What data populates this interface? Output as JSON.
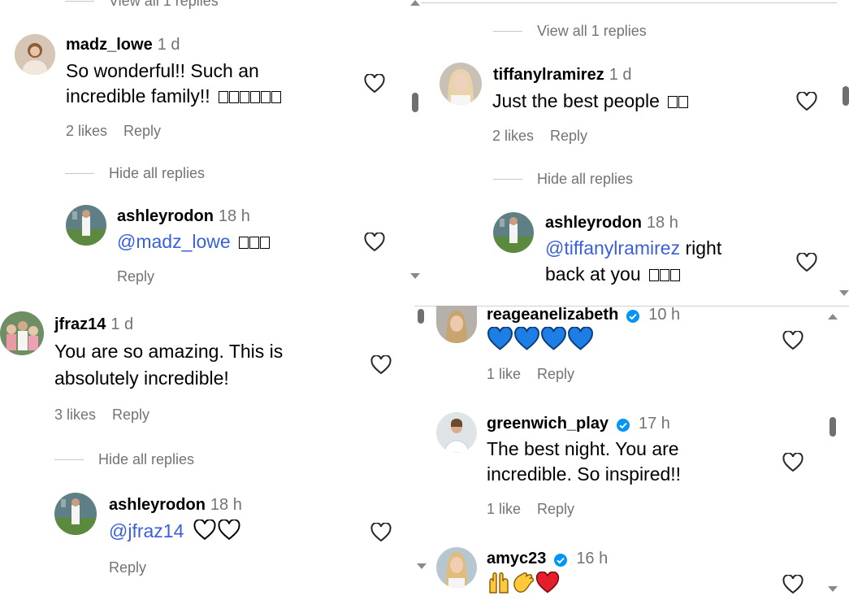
{
  "panel_top_left": {
    "view_replies_top": "View all 1 replies",
    "comment": {
      "user": "madz_lowe",
      "time": "1 d",
      "line1": "So wonderful!! Such an",
      "line2": "incredible family!!",
      "likes": "2 likes",
      "reply": "Reply"
    },
    "hide_replies": "Hide all replies",
    "reply_comment": {
      "user": "ashleyrodon",
      "time": "18 h",
      "mention": "@madz_lowe",
      "reply": "Reply"
    }
  },
  "panel_top_right": {
    "view_replies": "View all 1 replies",
    "comment": {
      "user": "tiffanylramirez",
      "time": "1 d",
      "text": "Just the best people",
      "likes": "2 likes",
      "reply": "Reply"
    },
    "hide_replies": "Hide all replies",
    "reply_comment": {
      "user": "ashleyrodon",
      "time": "18 h",
      "mention": "@tiffanylramirez",
      "after_mention": " right",
      "line2": "back at you"
    }
  },
  "panel_bottom_left": {
    "comment": {
      "user": "jfraz14",
      "time": "1 d",
      "line1": "You are so amazing. This is",
      "line2": "absolutely incredible!",
      "likes": "3 likes",
      "reply": "Reply"
    },
    "hide_replies": "Hide all replies",
    "reply_comment": {
      "user": "ashleyrodon",
      "time": "18 h",
      "mention": "@jfraz14",
      "reply": "Reply"
    }
  },
  "panel_bottom_right": {
    "comments": [
      {
        "user": "reageanelizabeth",
        "time": "10 h",
        "likes": "1 like",
        "reply": "Reply"
      },
      {
        "user": "greenwich_play",
        "time": "17 h",
        "line1": "The best night. You are",
        "line2": "incredible. So inspired!!",
        "likes": "1 like",
        "reply": "Reply"
      },
      {
        "user": "amyc23",
        "time": "16 h"
      }
    ]
  },
  "colors": {
    "accent_link": "#3b5fd9",
    "verified": "#0095f6",
    "heart_blue": "#1d7fe6",
    "heart_red": "#e41e2b"
  }
}
